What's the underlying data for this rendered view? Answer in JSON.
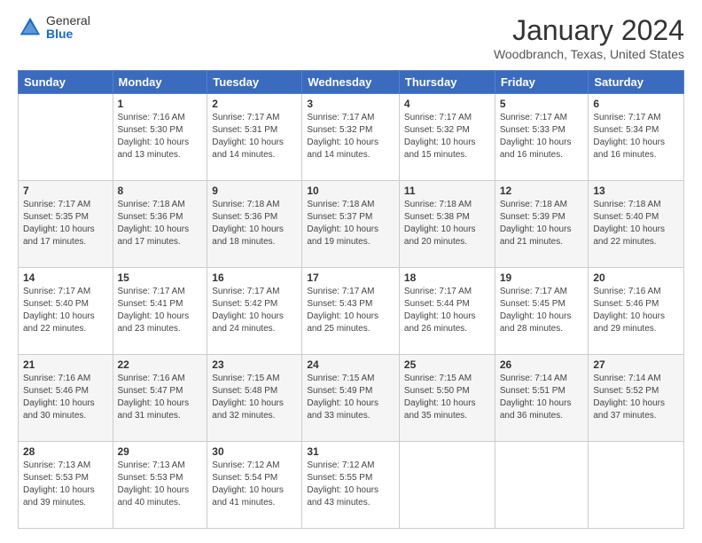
{
  "header": {
    "logo_general": "General",
    "logo_blue": "Blue",
    "month_title": "January 2024",
    "location": "Woodbranch, Texas, United States"
  },
  "weekdays": [
    "Sunday",
    "Monday",
    "Tuesday",
    "Wednesday",
    "Thursday",
    "Friday",
    "Saturday"
  ],
  "weeks": [
    [
      {
        "day": "",
        "sunrise": "",
        "sunset": "",
        "daylight": ""
      },
      {
        "day": "1",
        "sunrise": "Sunrise: 7:16 AM",
        "sunset": "Sunset: 5:30 PM",
        "daylight": "Daylight: 10 hours and 13 minutes."
      },
      {
        "day": "2",
        "sunrise": "Sunrise: 7:17 AM",
        "sunset": "Sunset: 5:31 PM",
        "daylight": "Daylight: 10 hours and 14 minutes."
      },
      {
        "day": "3",
        "sunrise": "Sunrise: 7:17 AM",
        "sunset": "Sunset: 5:32 PM",
        "daylight": "Daylight: 10 hours and 14 minutes."
      },
      {
        "day": "4",
        "sunrise": "Sunrise: 7:17 AM",
        "sunset": "Sunset: 5:32 PM",
        "daylight": "Daylight: 10 hours and 15 minutes."
      },
      {
        "day": "5",
        "sunrise": "Sunrise: 7:17 AM",
        "sunset": "Sunset: 5:33 PM",
        "daylight": "Daylight: 10 hours and 16 minutes."
      },
      {
        "day": "6",
        "sunrise": "Sunrise: 7:17 AM",
        "sunset": "Sunset: 5:34 PM",
        "daylight": "Daylight: 10 hours and 16 minutes."
      }
    ],
    [
      {
        "day": "7",
        "sunrise": "Sunrise: 7:17 AM",
        "sunset": "Sunset: 5:35 PM",
        "daylight": "Daylight: 10 hours and 17 minutes."
      },
      {
        "day": "8",
        "sunrise": "Sunrise: 7:18 AM",
        "sunset": "Sunset: 5:36 PM",
        "daylight": "Daylight: 10 hours and 17 minutes."
      },
      {
        "day": "9",
        "sunrise": "Sunrise: 7:18 AM",
        "sunset": "Sunset: 5:36 PM",
        "daylight": "Daylight: 10 hours and 18 minutes."
      },
      {
        "day": "10",
        "sunrise": "Sunrise: 7:18 AM",
        "sunset": "Sunset: 5:37 PM",
        "daylight": "Daylight: 10 hours and 19 minutes."
      },
      {
        "day": "11",
        "sunrise": "Sunrise: 7:18 AM",
        "sunset": "Sunset: 5:38 PM",
        "daylight": "Daylight: 10 hours and 20 minutes."
      },
      {
        "day": "12",
        "sunrise": "Sunrise: 7:18 AM",
        "sunset": "Sunset: 5:39 PM",
        "daylight": "Daylight: 10 hours and 21 minutes."
      },
      {
        "day": "13",
        "sunrise": "Sunrise: 7:18 AM",
        "sunset": "Sunset: 5:40 PM",
        "daylight": "Daylight: 10 hours and 22 minutes."
      }
    ],
    [
      {
        "day": "14",
        "sunrise": "Sunrise: 7:17 AM",
        "sunset": "Sunset: 5:40 PM",
        "daylight": "Daylight: 10 hours and 22 minutes."
      },
      {
        "day": "15",
        "sunrise": "Sunrise: 7:17 AM",
        "sunset": "Sunset: 5:41 PM",
        "daylight": "Daylight: 10 hours and 23 minutes."
      },
      {
        "day": "16",
        "sunrise": "Sunrise: 7:17 AM",
        "sunset": "Sunset: 5:42 PM",
        "daylight": "Daylight: 10 hours and 24 minutes."
      },
      {
        "day": "17",
        "sunrise": "Sunrise: 7:17 AM",
        "sunset": "Sunset: 5:43 PM",
        "daylight": "Daylight: 10 hours and 25 minutes."
      },
      {
        "day": "18",
        "sunrise": "Sunrise: 7:17 AM",
        "sunset": "Sunset: 5:44 PM",
        "daylight": "Daylight: 10 hours and 26 minutes."
      },
      {
        "day": "19",
        "sunrise": "Sunrise: 7:17 AM",
        "sunset": "Sunset: 5:45 PM",
        "daylight": "Daylight: 10 hours and 28 minutes."
      },
      {
        "day": "20",
        "sunrise": "Sunrise: 7:16 AM",
        "sunset": "Sunset: 5:46 PM",
        "daylight": "Daylight: 10 hours and 29 minutes."
      }
    ],
    [
      {
        "day": "21",
        "sunrise": "Sunrise: 7:16 AM",
        "sunset": "Sunset: 5:46 PM",
        "daylight": "Daylight: 10 hours and 30 minutes."
      },
      {
        "day": "22",
        "sunrise": "Sunrise: 7:16 AM",
        "sunset": "Sunset: 5:47 PM",
        "daylight": "Daylight: 10 hours and 31 minutes."
      },
      {
        "day": "23",
        "sunrise": "Sunrise: 7:15 AM",
        "sunset": "Sunset: 5:48 PM",
        "daylight": "Daylight: 10 hours and 32 minutes."
      },
      {
        "day": "24",
        "sunrise": "Sunrise: 7:15 AM",
        "sunset": "Sunset: 5:49 PM",
        "daylight": "Daylight: 10 hours and 33 minutes."
      },
      {
        "day": "25",
        "sunrise": "Sunrise: 7:15 AM",
        "sunset": "Sunset: 5:50 PM",
        "daylight": "Daylight: 10 hours and 35 minutes."
      },
      {
        "day": "26",
        "sunrise": "Sunrise: 7:14 AM",
        "sunset": "Sunset: 5:51 PM",
        "daylight": "Daylight: 10 hours and 36 minutes."
      },
      {
        "day": "27",
        "sunrise": "Sunrise: 7:14 AM",
        "sunset": "Sunset: 5:52 PM",
        "daylight": "Daylight: 10 hours and 37 minutes."
      }
    ],
    [
      {
        "day": "28",
        "sunrise": "Sunrise: 7:13 AM",
        "sunset": "Sunset: 5:53 PM",
        "daylight": "Daylight: 10 hours and 39 minutes."
      },
      {
        "day": "29",
        "sunrise": "Sunrise: 7:13 AM",
        "sunset": "Sunset: 5:53 PM",
        "daylight": "Daylight: 10 hours and 40 minutes."
      },
      {
        "day": "30",
        "sunrise": "Sunrise: 7:12 AM",
        "sunset": "Sunset: 5:54 PM",
        "daylight": "Daylight: 10 hours and 41 minutes."
      },
      {
        "day": "31",
        "sunrise": "Sunrise: 7:12 AM",
        "sunset": "Sunset: 5:55 PM",
        "daylight": "Daylight: 10 hours and 43 minutes."
      },
      {
        "day": "",
        "sunrise": "",
        "sunset": "",
        "daylight": ""
      },
      {
        "day": "",
        "sunrise": "",
        "sunset": "",
        "daylight": ""
      },
      {
        "day": "",
        "sunrise": "",
        "sunset": "",
        "daylight": ""
      }
    ]
  ]
}
